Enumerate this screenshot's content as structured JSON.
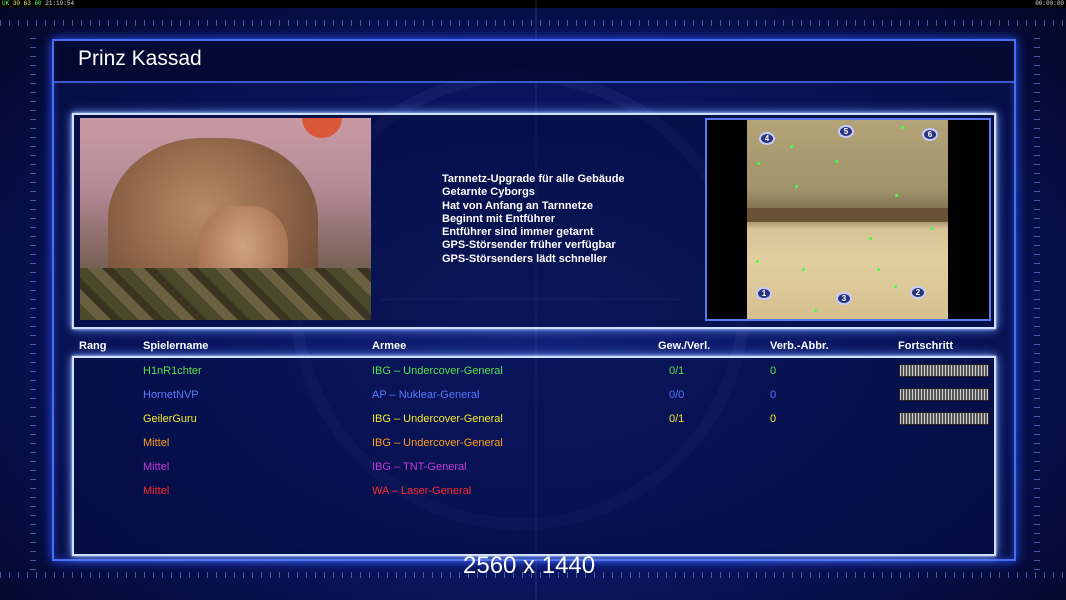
{
  "hud": {
    "left_a": "UK",
    "left_b": "30",
    "left_c": "63",
    "left_d": "60",
    "left_time": "21:19:54",
    "right_time": "00:00:00"
  },
  "title": "Prinz Kassad",
  "perks": [
    "Tarnnetz-Upgrade für alle Gebäude",
    "Getarnte Cyborgs",
    "Hat von Anfang an Tarnnetze",
    "Beginnt mit Entführer",
    "Entführer sind immer getarnt",
    "GPS-Störsender früher verfügbar",
    "GPS-Störsenders lädt schneller"
  ],
  "map_spawns": [
    "4",
    "5",
    "6",
    "1",
    "3",
    "2"
  ],
  "columns": {
    "rank": "Rang",
    "player": "Spielername",
    "army": "Armee",
    "winloss": "Gew./Verl.",
    "disconnect": "Verb.-Abbr.",
    "progress": "Fortschritt"
  },
  "players": [
    {
      "name": "H1nR1chter",
      "army": "IBG – Undercover-General",
      "winloss": "0/1",
      "disc": "0",
      "color": "#57e04a",
      "progress": 1.0
    },
    {
      "name": "HornetNVP",
      "army": "AP – Nuklear-General",
      "winloss": "0/0",
      "disc": "0",
      "color": "#5a78ff",
      "progress": 1.0
    },
    {
      "name": "GeilerGuru",
      "army": "IBG – Undercover-General",
      "winloss": "0/1",
      "disc": "0",
      "color": "#f3ea2c",
      "progress": 1.0
    },
    {
      "name": "Mittel",
      "army": "IBG – Undercover-General",
      "winloss": "",
      "disc": "",
      "color": "#ff9f1c",
      "progress": null
    },
    {
      "name": "Mittel",
      "army": "IBG – TNT-General",
      "winloss": "",
      "disc": "",
      "color": "#c23ad6",
      "progress": null
    },
    {
      "name": "Mittel",
      "army": "WA – Laser-General",
      "winloss": "",
      "disc": "",
      "color": "#ff2a2a",
      "progress": null
    }
  ],
  "resolution": "2560 x 1440"
}
